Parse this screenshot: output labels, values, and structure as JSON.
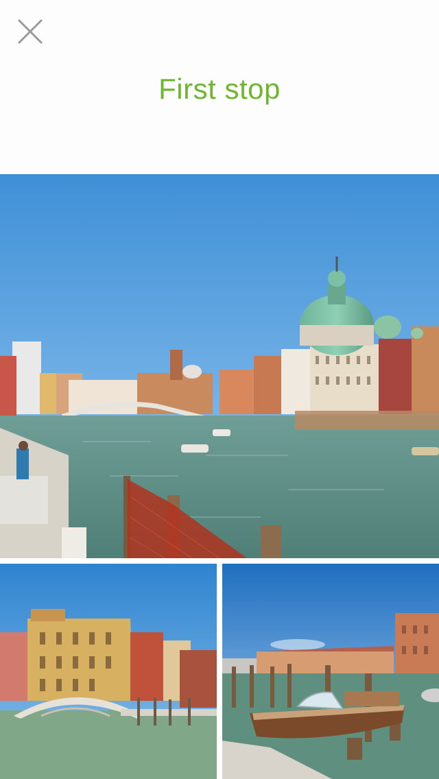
{
  "header": {
    "title": "First stop",
    "close_icon": "close-icon",
    "title_color": "#6fb531"
  },
  "gallery": {
    "photos": [
      {
        "id": "main",
        "subject": "grand-canal-with-green-dome"
      },
      {
        "id": "bottom-left",
        "subject": "canal-bridge-with-ochre-buildings"
      },
      {
        "id": "bottom-right",
        "subject": "wooden-water-taxi-at-dock"
      }
    ]
  }
}
